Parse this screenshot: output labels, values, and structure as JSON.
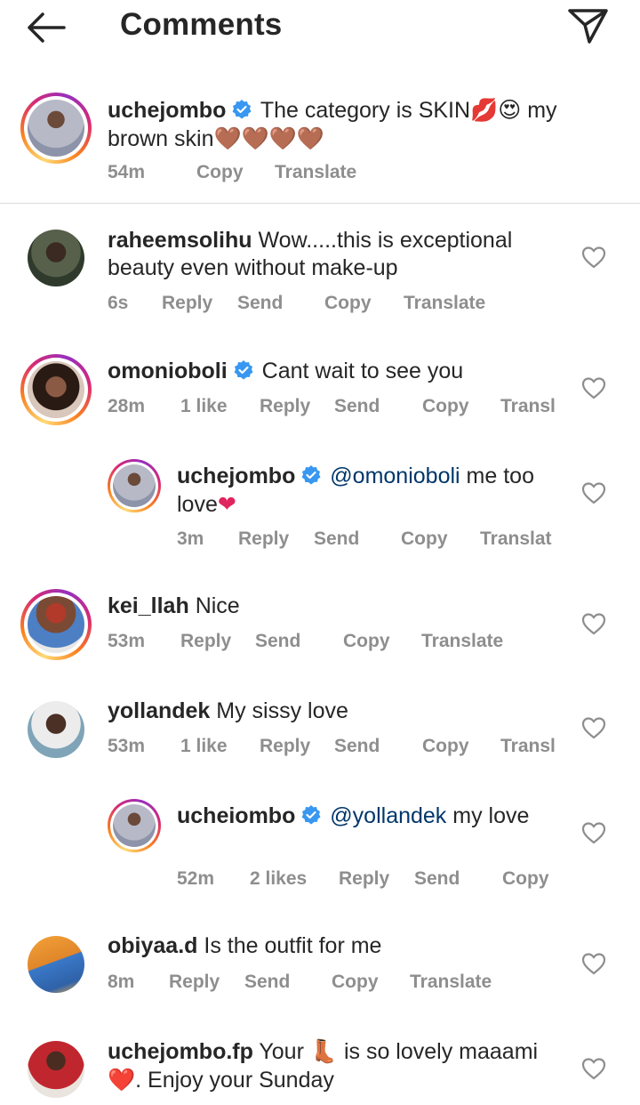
{
  "header": {
    "title": "Comments"
  },
  "caption": {
    "username": "uchejombo",
    "text": "The category is SKIN",
    "emoji_a": "💋😍",
    "text2": "my brown skin",
    "hearts": "🤎🤎🤎🤎",
    "time": "54m",
    "copy": "Copy",
    "translate": "Translate"
  },
  "comments": [
    {
      "username": "raheemsolihu",
      "text": "Wow.....this is exceptional",
      "text2": "beauty even without make-up",
      "time": "6s",
      "reply": "Reply",
      "send": "Send",
      "copy": "Copy",
      "translate": "Translate"
    },
    {
      "username": "omonioboli",
      "text": "Cant wait to see you",
      "time": "28m",
      "likes": "1 like",
      "reply": "Reply",
      "send": "Send",
      "copy": "Copy",
      "translate": "Transl"
    },
    {
      "username": "uchejombo",
      "mention": "@omonioboli",
      "text": "me too",
      "text2": "love",
      "time": "3m",
      "reply": "Reply",
      "send": "Send",
      "copy": "Copy",
      "translate": "Translat"
    },
    {
      "username": "kei_llah",
      "text": "Nice",
      "time": "53m",
      "reply": "Reply",
      "send": "Send",
      "copy": "Copy",
      "translate": "Translate"
    },
    {
      "username": "yollandek",
      "text": "My sissy love",
      "time": "53m",
      "likes": "1 like",
      "reply": "Reply",
      "send": "Send",
      "copy": "Copy",
      "translate": "Transl"
    },
    {
      "username": "ucheiombo",
      "mention": "@yollandek",
      "text": "my love",
      "time": "52m",
      "likes": "2 likes",
      "reply": "Reply",
      "send": "Send",
      "copy": "Copy"
    },
    {
      "username": "obiyaa.d",
      "text": "Is the outfit for me",
      "time": "8m",
      "reply": "Reply",
      "send": "Send",
      "copy": "Copy",
      "translate": "Translate"
    },
    {
      "username": "uchejombo.fp",
      "text": "Your",
      "emoji": "👢",
      "text2": "is so lovely maaami",
      "heart": "❤️",
      "text3": ". Enjoy your Sunday"
    }
  ],
  "colors": {
    "text": "#262626",
    "meta": "#8e8e8e",
    "verified": "#3897f0",
    "mention": "#00376b",
    "divider": "#dbdbdb"
  },
  "icons": [
    "back-arrow-icon",
    "direct-send-icon",
    "verified-badge-icon",
    "heart-outline-icon"
  ]
}
